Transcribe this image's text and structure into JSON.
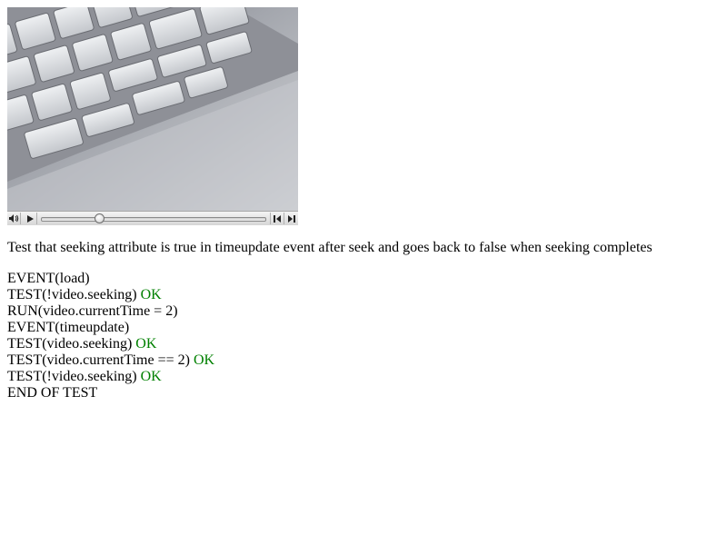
{
  "video": {
    "progress_fraction": 0.26,
    "icons": {
      "mute": "speaker-icon",
      "play": "play-icon",
      "rewind": "rewind-icon",
      "fast_forward": "fast-forward-icon"
    }
  },
  "description": "Test that seeking attribute is true in timeupdate event after seek and goes back to false when seeking completes",
  "colors": {
    "ok": "#008000"
  },
  "log": [
    {
      "text": "EVENT(load)",
      "status": ""
    },
    {
      "text": "TEST(!video.seeking)",
      "status": "OK"
    },
    {
      "text": "RUN(video.currentTime = 2)",
      "status": ""
    },
    {
      "text": "EVENT(timeupdate)",
      "status": ""
    },
    {
      "text": "TEST(video.seeking)",
      "status": "OK"
    },
    {
      "text": "TEST(video.currentTime == 2)",
      "status": "OK"
    },
    {
      "text": "TEST(!video.seeking)",
      "status": "OK"
    },
    {
      "text": "END OF TEST",
      "status": ""
    }
  ]
}
